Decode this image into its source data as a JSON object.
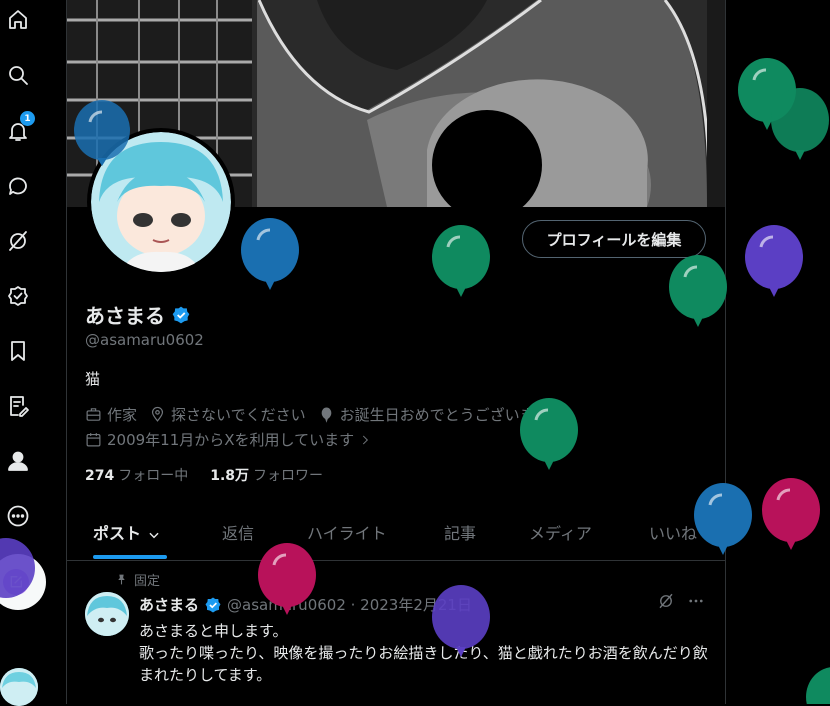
{
  "nav": {
    "notification_count": "1",
    "items": [
      "home-icon",
      "search-icon",
      "bell-icon",
      "chat-icon",
      "grok-icon",
      "verified-icon",
      "bookmark-icon",
      "edit-note-icon",
      "person-icon",
      "more-icon"
    ]
  },
  "profile": {
    "edit_button": "プロフィールを編集",
    "display_name": "あさまる",
    "handle": "@asamaru0602",
    "bio": "猫",
    "occupation": "作家",
    "location": "探さないでください",
    "birthday": "お誕生日おめでとうございます。",
    "joined": "2009年11月からXを利用しています",
    "following_count": "274",
    "following_label": "フォロー中",
    "followers_count": "1.8万",
    "followers_label": "フォロワー"
  },
  "tabs": [
    {
      "label": "ポスト"
    },
    {
      "label": "返信"
    },
    {
      "label": "ハイライト"
    },
    {
      "label": "記事"
    },
    {
      "label": "メディア"
    },
    {
      "label": "いいね"
    }
  ],
  "pinned_post": {
    "pinned_label": "固定",
    "name": "あさまる",
    "handle_date": "@asamaru0602 · 2023年2月21日",
    "text_line1": "あさまると申します。",
    "text_line2": "歌ったり喋ったり、映像を撮ったりお絵描きしたり、猫と戯れたりお酒を飲んだり飲まれたりしてます。"
  },
  "colors": {
    "accent": "#1d9bf0",
    "balloon_green": "#0f8a5f",
    "balloon_blue": "#1a6fb0",
    "balloon_purple": "#5b3fc4",
    "balloon_pink": "#b8125a"
  }
}
